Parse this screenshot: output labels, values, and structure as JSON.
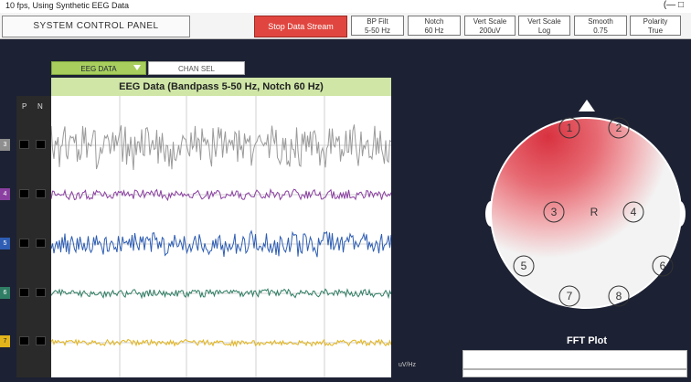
{
  "window": {
    "title": "10 fps, Using Synthetic EEG Data",
    "controls": "(—  □"
  },
  "topbar": {
    "system_label": "SYSTEM CONTROL PANEL",
    "stop_button": "Stop Data Stream",
    "filters": [
      {
        "line1": "BP Filt",
        "line2": "5-50 Hz"
      },
      {
        "line1": "Notch",
        "line2": "60 Hz"
      },
      {
        "line1": "Vert Scale",
        "line2": "200uV"
      },
      {
        "line1": "Vert Scale",
        "line2": "Log"
      },
      {
        "line1": "Smooth",
        "line2": "0.75"
      },
      {
        "line1": "Polarity",
        "line2": "True"
      }
    ]
  },
  "tabs": {
    "eeg": "EEG DATA",
    "chan": "CHAN SEL"
  },
  "eeg": {
    "header": "EEG Data (Bandpass 5-50 Hz, Notch 60 Hz)",
    "p_label": "P",
    "n_label": "N",
    "channels": [
      {
        "id": "3",
        "color": "#9a9a9a"
      },
      {
        "id": "4",
        "color": "#8a3fa0"
      },
      {
        "id": "5",
        "color": "#2e5db3"
      },
      {
        "id": "6",
        "color": "#2f7d64"
      },
      {
        "id": "7",
        "color": "#e2b41c"
      }
    ]
  },
  "head": {
    "electrodes": [
      "1",
      "2",
      "3",
      "4",
      "5",
      "6",
      "7",
      "8"
    ],
    "ref_label": "R"
  },
  "fft": {
    "label": "FFT Plot",
    "axis_label": "uV/Hz"
  }
}
